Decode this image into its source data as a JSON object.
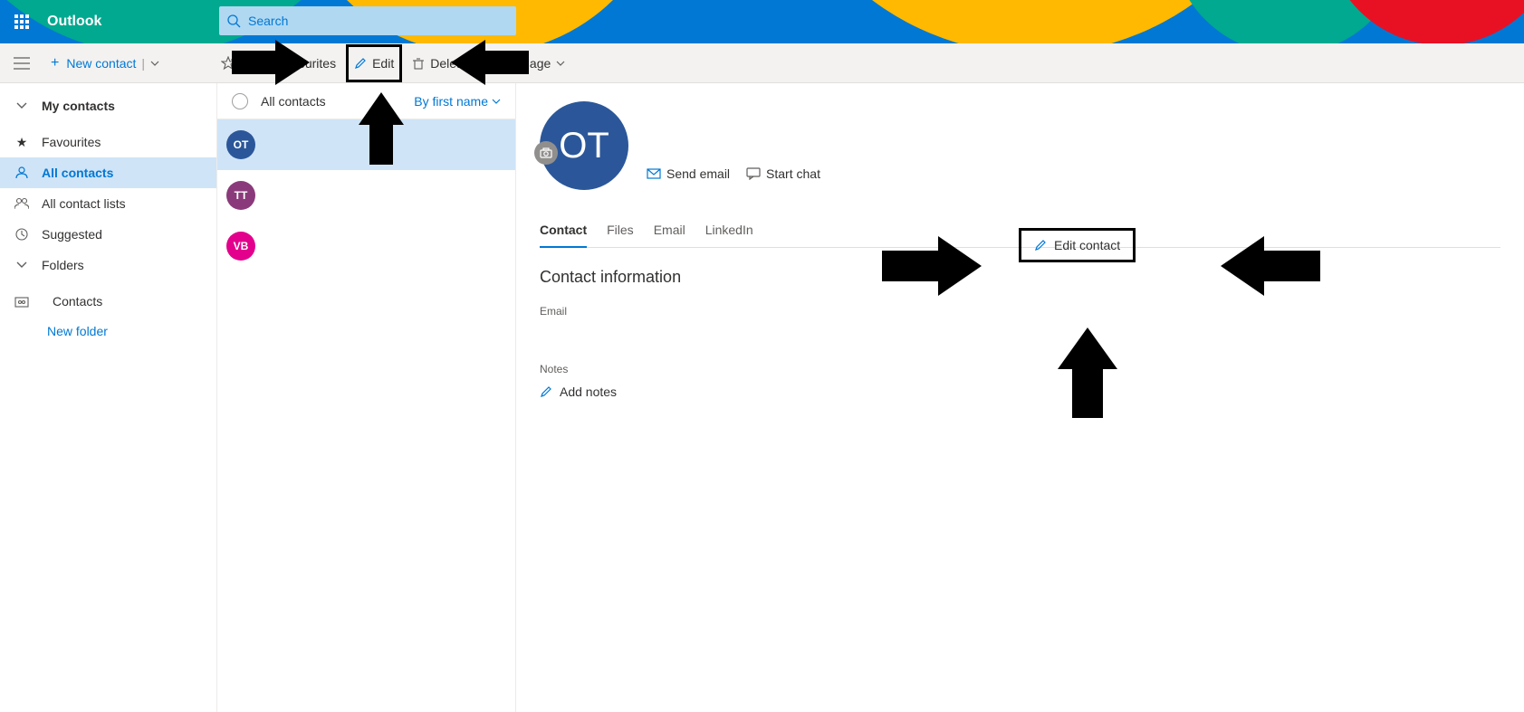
{
  "header": {
    "app": "Outlook",
    "search_placeholder": "Search"
  },
  "commandbar": {
    "new_contact": "New contact",
    "add_favourites": "Add to favourites",
    "edit": "Edit",
    "delete": "Delete",
    "manage": "Manage"
  },
  "leftnav": {
    "my_contacts": "My contacts",
    "favourites": "Favourites",
    "all_contacts": "All contacts",
    "all_contact_lists": "All contact lists",
    "suggested": "Suggested",
    "folders": "Folders",
    "contacts_folder": "Contacts",
    "new_folder": "New folder"
  },
  "list": {
    "title": "All contacts",
    "sort": "By first name",
    "items": [
      {
        "initials": "OT",
        "color": "#2b579a"
      },
      {
        "initials": "TT",
        "color": "#8a3a7a"
      },
      {
        "initials": "VB",
        "color": "#e3008c"
      }
    ]
  },
  "detail": {
    "initials": "OT",
    "send_email": "Send email",
    "start_chat": "Start chat",
    "tabs": {
      "contact": "Contact",
      "files": "Files",
      "email": "Email",
      "linkedin": "LinkedIn"
    },
    "contact_info_title": "Contact information",
    "email_label": "Email",
    "notes_label": "Notes",
    "add_notes": "Add notes",
    "edit_contact": "Edit contact"
  }
}
